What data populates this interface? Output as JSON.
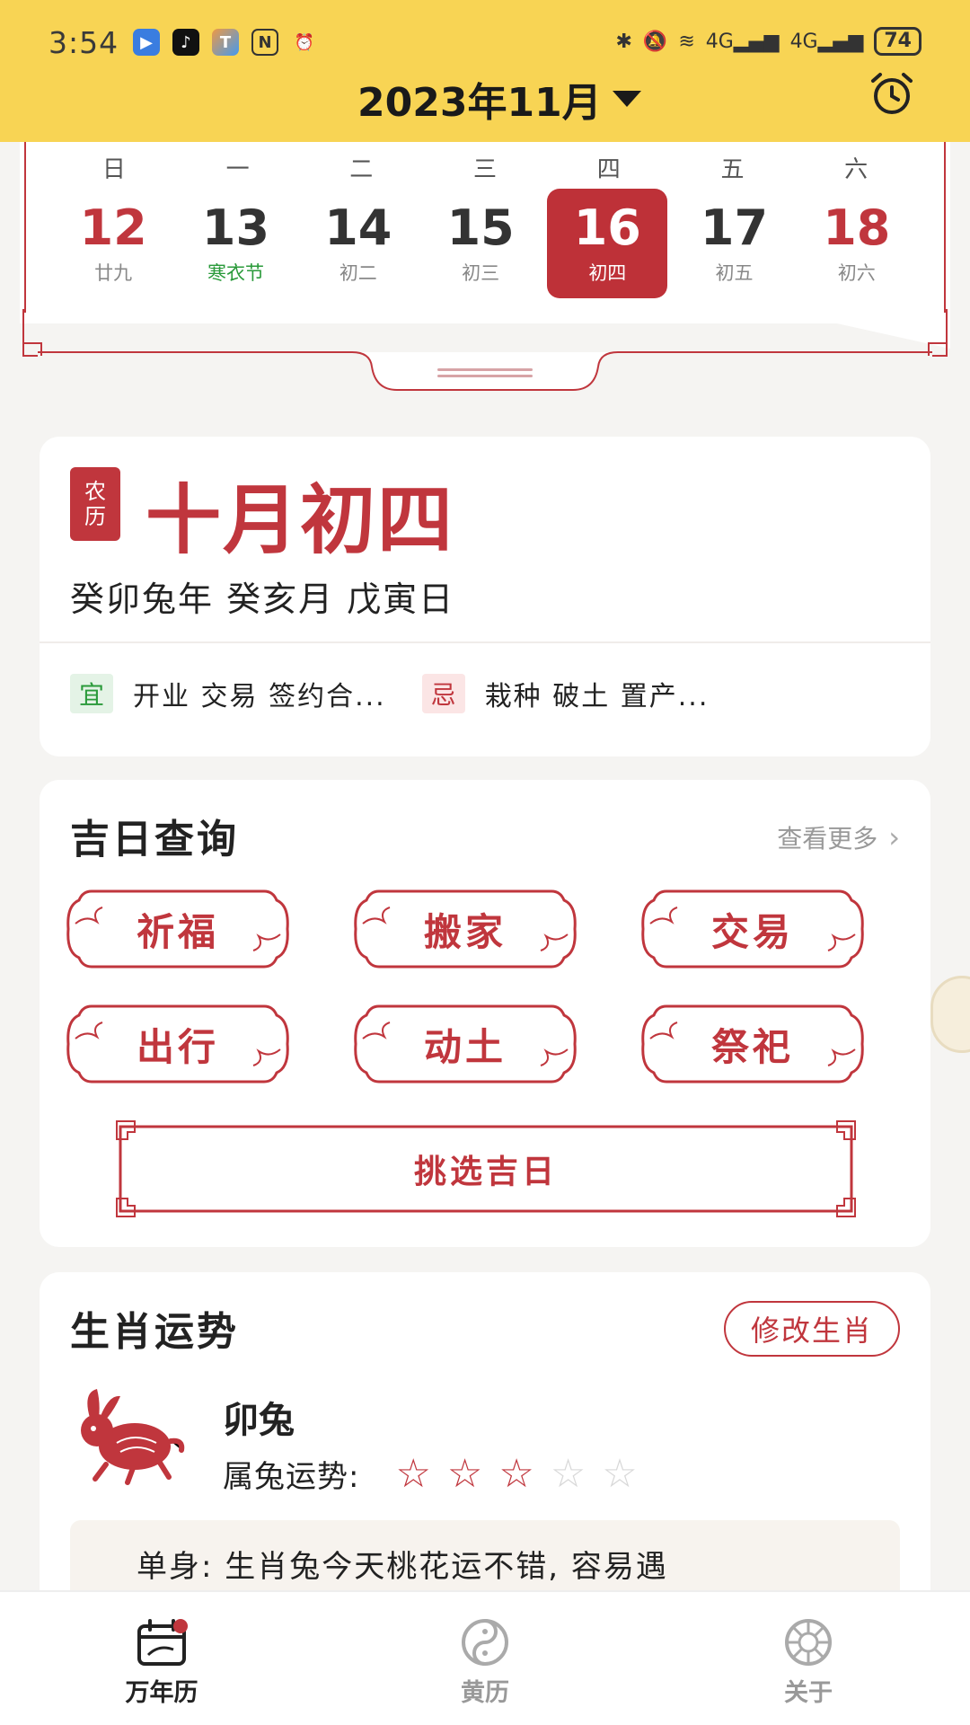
{
  "status_bar": {
    "time": "3:54",
    "battery": "74",
    "network_label_1": "4G",
    "network_label_2": "4G"
  },
  "header": {
    "month_label": "2023年11月"
  },
  "week": {
    "weekdays": [
      "日",
      "一",
      "二",
      "三",
      "四",
      "五",
      "六"
    ],
    "days": [
      {
        "num": "12",
        "sub": "廿九"
      },
      {
        "num": "13",
        "sub": "寒衣节"
      },
      {
        "num": "14",
        "sub": "初二"
      },
      {
        "num": "15",
        "sub": "初三"
      },
      {
        "num": "16",
        "sub": "初四"
      },
      {
        "num": "17",
        "sub": "初五"
      },
      {
        "num": "18",
        "sub": "初六"
      }
    ]
  },
  "lunar": {
    "badge_1": "农",
    "badge_2": "历",
    "date": "十月初四",
    "ganzhi": "癸卯兔年 癸亥月 戊寅日",
    "yi_tag": "宜",
    "yi_text": "开业 交易 签约合...",
    "ji_tag": "忌",
    "ji_text": "栽种 破土 置产..."
  },
  "jiri": {
    "title": "吉日查询",
    "more": "查看更多",
    "buttons": [
      "祈福",
      "搬家",
      "交易",
      "出行",
      "动土",
      "祭祀"
    ],
    "pick": "挑选吉日"
  },
  "shengxiao": {
    "title": "生肖运势",
    "edit": "修改生肖",
    "name": "卯兔",
    "fortune_label": "属兔运势:",
    "rating": 3,
    "rating_max": 5,
    "text": "单身: 生肖兔今天桃花运不错, 容易遇"
  },
  "tabs": [
    {
      "label": "万年历",
      "icon": "calendar-icon"
    },
    {
      "label": "黄历",
      "icon": "yin-yang-icon"
    },
    {
      "label": "关于",
      "icon": "compass-icon"
    }
  ],
  "colors": {
    "header_bg": "#f8d454",
    "accent_red": "#c0363d",
    "festival_green": "#2a9a3a"
  }
}
